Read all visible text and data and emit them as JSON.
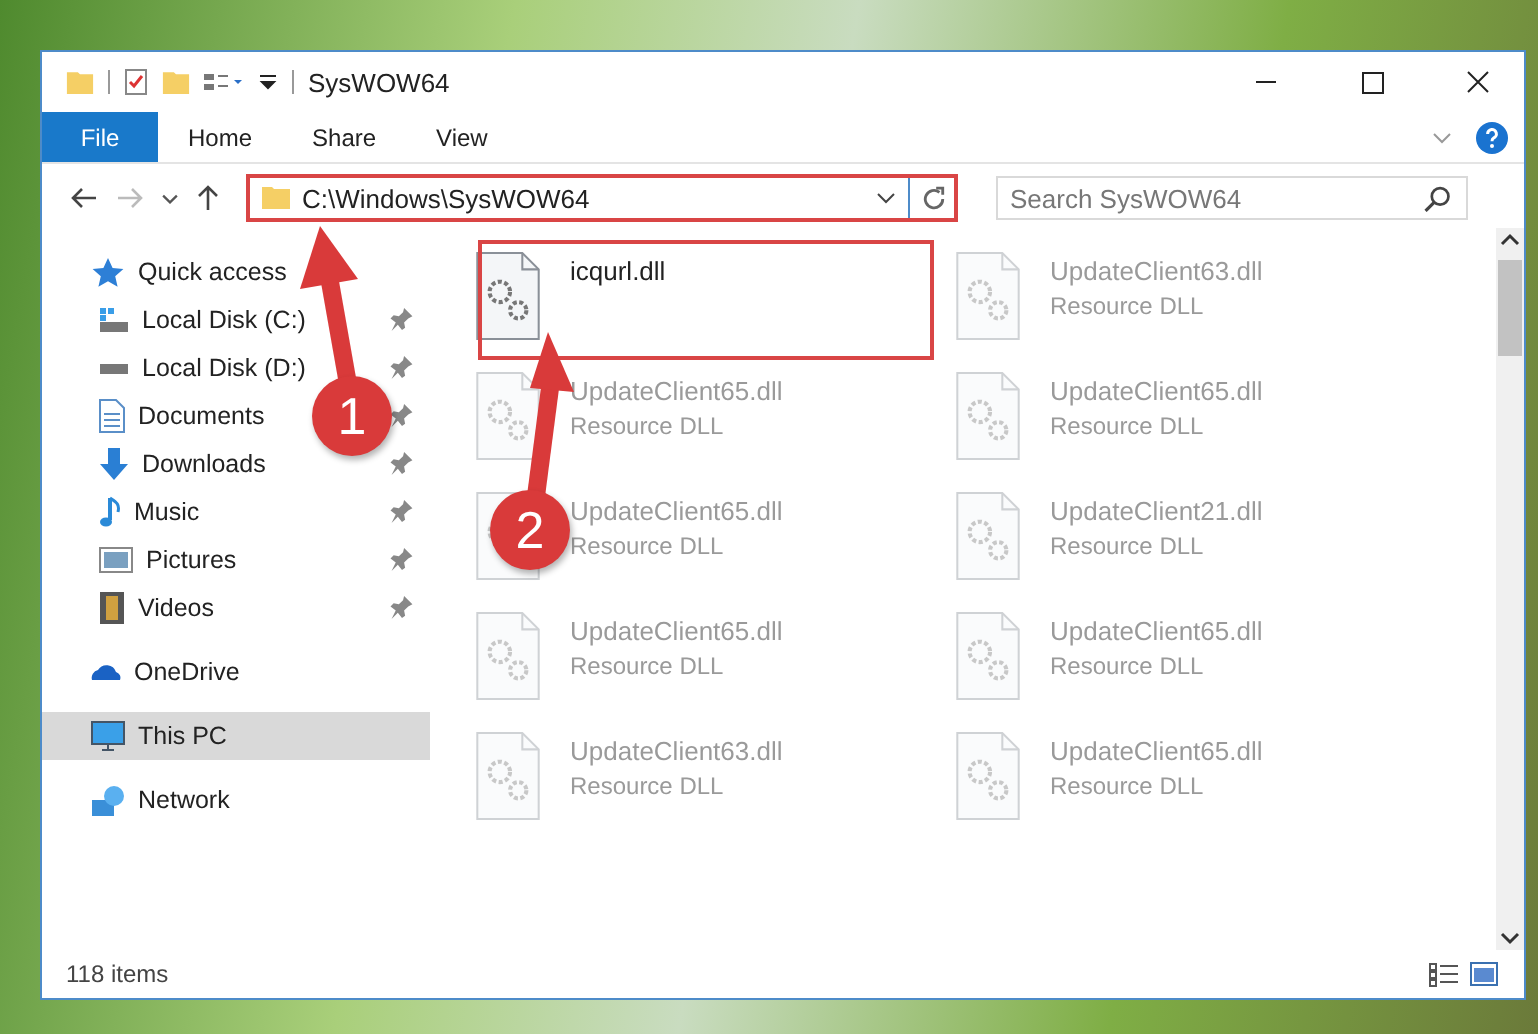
{
  "window": {
    "title": "SysWOW64"
  },
  "ribbon_tabs": [
    {
      "label": "File",
      "kind": "file"
    },
    {
      "label": "Home",
      "kind": "tab"
    },
    {
      "label": "Share",
      "kind": "tab"
    },
    {
      "label": "View",
      "kind": "tab"
    }
  ],
  "address": {
    "value": "C:\\Windows\\SysWOW64"
  },
  "search": {
    "placeholder": "Search SysWOW64"
  },
  "nav": [
    {
      "label": "Quick access",
      "kind": "star",
      "selected": false,
      "children": [
        {
          "label": "Local Disk (C:)",
          "kind": "drive-os",
          "selected": false,
          "pinned": true
        },
        {
          "label": "Local Disk (D:)",
          "kind": "drive",
          "selected": false,
          "pinned": true
        },
        {
          "label": "Documents",
          "kind": "document",
          "selected": false,
          "pinned": true
        },
        {
          "label": "Downloads",
          "kind": "download",
          "selected": false,
          "pinned": true
        },
        {
          "label": "Music",
          "kind": "music",
          "selected": false,
          "pinned": true
        },
        {
          "label": "Pictures",
          "kind": "picture",
          "selected": false,
          "pinned": true
        },
        {
          "label": "Videos",
          "kind": "video",
          "selected": false,
          "pinned": true
        }
      ]
    },
    {
      "label": "OneDrive",
      "kind": "cloud",
      "selected": false
    },
    {
      "label": "This PC",
      "kind": "computer",
      "selected": true
    },
    {
      "label": "Network",
      "kind": "network",
      "selected": false
    }
  ],
  "files": [
    {
      "name": "icqurl.dll",
      "blurred": false
    },
    {
      "name": "UpdateClient63.dll",
      "type": "Resource DLL",
      "blurred": true
    },
    {
      "name": "UpdateClient65.dll",
      "type": "Resource DLL",
      "blurred": true
    },
    {
      "name": "UpdateClient65.dll",
      "type": "Resource DLL",
      "blurred": true
    },
    {
      "name": "UpdateClient65.dll",
      "type": "Resource DLL",
      "blurred": true
    },
    {
      "name": "UpdateClient21.dll",
      "type": "Resource DLL",
      "blurred": true
    },
    {
      "name": "UpdateClient65.dll",
      "type": "Resource DLL",
      "blurred": true
    },
    {
      "name": "UpdateClient65.dll",
      "type": "Resource DLL",
      "blurred": true
    },
    {
      "name": "UpdateClient63.dll",
      "type": "Resource DLL",
      "blurred": true
    },
    {
      "name": "UpdateClient65.dll",
      "type": "Resource DLL",
      "blurred": true
    }
  ],
  "status_bar": {
    "item_count": "118 items"
  },
  "annotations": [
    {
      "number": "1"
    },
    {
      "number": "2"
    }
  ]
}
